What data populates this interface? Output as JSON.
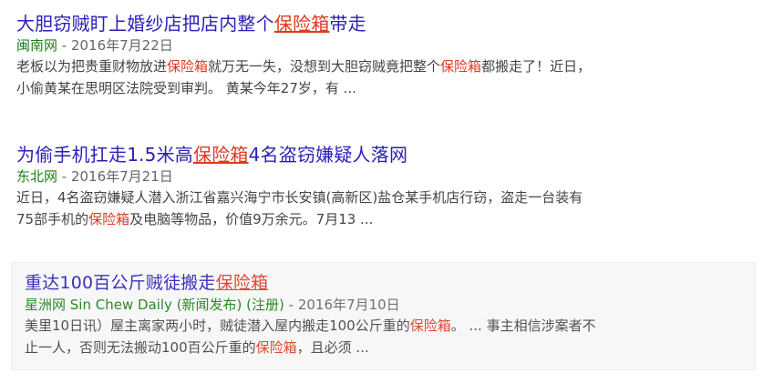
{
  "results": [
    {
      "title_before": "大胆窃贼盯上婚纱店把店内整个",
      "title_hl": "保险箱",
      "title_after": "带走",
      "source": "闽南网",
      "source_extra": "",
      "date": " - 2016年7月22日",
      "line1_a": "老板以为把贵重财物放进",
      "line1_hl": "保险箱",
      "line1_b": "就万无一失，没想到大胆窃贼竟把整个",
      "line1_hl2": "保险箱",
      "line1_c": "都搬走了！近日，",
      "line2": "小偷黄某在思明区法院受到审判。 黄某今年27岁，有 ..."
    },
    {
      "title_before": "为偷手机扛走1.5米高",
      "title_hl": "保险箱",
      "title_after": "4名盗窃嫌疑人落网",
      "source": "东北网",
      "date": " - 2016年7月21日",
      "line1": "近日，4名盗窃嫌疑人潜入浙江省嘉兴海宁市长安镇(高新区)盐仓某手机店行窃，盗走一台装有",
      "line2_a": "75部手机的",
      "line2_hl": "保险箱",
      "line2_b": "及电脑等物品，价值9万余元。7月13 ..."
    },
    {
      "title_before": "重达100百公斤贼徒搬走",
      "title_hl": "保险箱",
      "title_after": "",
      "source": "星洲网 Sin Chew Daily (新闻发布) (注册)",
      "date": " - 2016年7月10日",
      "line1_a": "美里10日讯）屋主离家两小时，贼徒潜入屋内搬走100公斤重的",
      "line1_hl": "保险箱",
      "line1_b": "。 ... 事主相信涉案者不",
      "line2_a": "止一人，否则无法搬动100百公斤重的",
      "line2_hl": "保险箱",
      "line2_b": "，且必须 ..."
    }
  ]
}
